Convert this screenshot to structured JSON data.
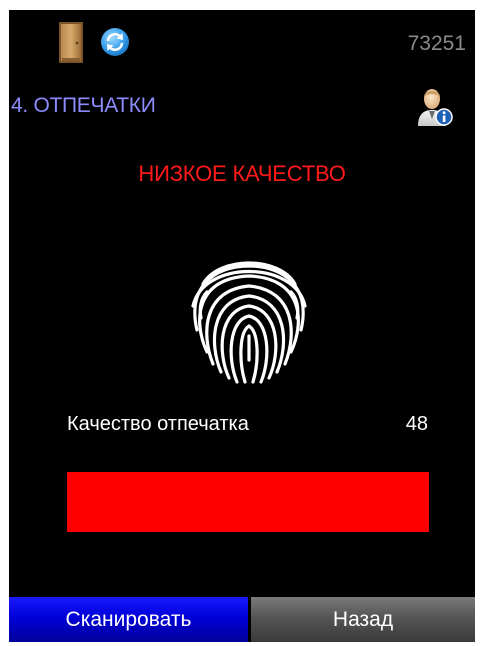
{
  "status_bar": {
    "door_icon": "door-icon",
    "sync_icon": "sync-icon",
    "device_id": "73251"
  },
  "header": {
    "title": "4. ОТПЕЧАТКИ",
    "user_icon": "user-info-icon"
  },
  "scan": {
    "status_text": "НИЗКОЕ КАЧЕСТВО",
    "status_color": "#ff1a1a",
    "fingerprint_icon": "fingerprint-icon",
    "quality_label": "Качество отпечатка",
    "quality_value": "48",
    "quality_bar_fill_fraction": 1.0,
    "quality_bar_color": "#ff0000"
  },
  "footer": {
    "scan_button": "Сканировать",
    "back_button": "Назад"
  },
  "colors": {
    "title": "#8c8cff",
    "scan_button": "#0000d8",
    "back_button": "#555555",
    "background": "#000000"
  }
}
